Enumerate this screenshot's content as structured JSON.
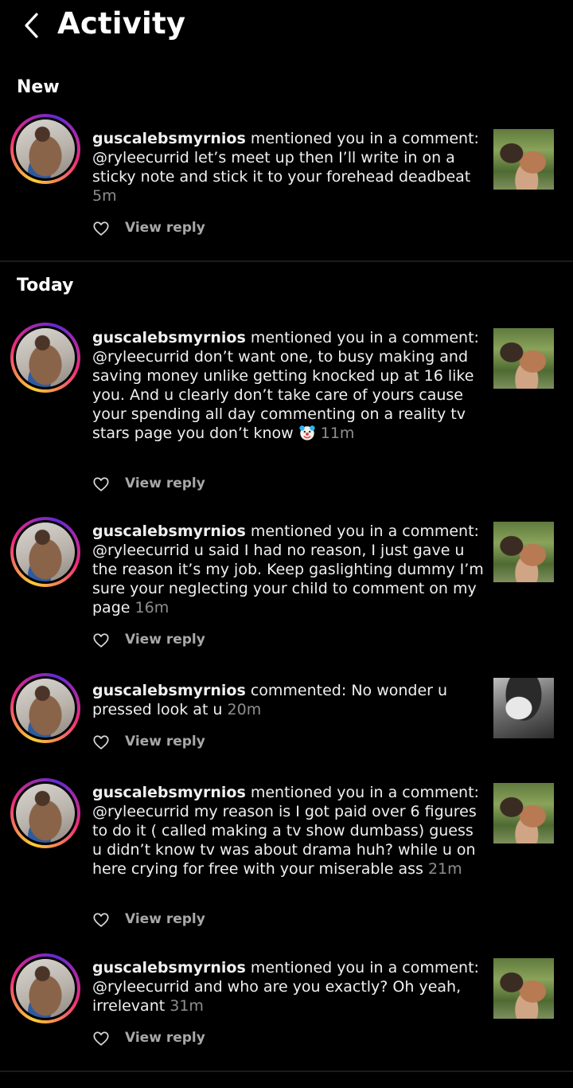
{
  "header": {
    "title": "Activity"
  },
  "sections": {
    "new": "New",
    "today": "Today"
  },
  "reply_label": "View reply",
  "notifications": [
    {
      "username": "guscalebsmyrnios",
      "action": "mentioned you in a comment:",
      "mention": "@ryleecurrid",
      "message": "let’s meet up then I’ll write in on a sticky note and stick it to your forehead deadbeat",
      "time": "5m"
    },
    {
      "username": "guscalebsmyrnios",
      "action": "mentioned you in a comment:",
      "mention": "@ryleecurrid",
      "message": "don’t want one, to busy making and saving money unlike getting knocked up at 16 like you. And u clearly don’t take care of yours cause your spending all day commenting on a reality tv stars page you don’t know",
      "emoji": "clown-face-emoji",
      "time": "11m"
    },
    {
      "username": "guscalebsmyrnios",
      "action": "mentioned you in a comment:",
      "mention": "@ryleecurrid",
      "message": "u said I had no reason, I just gave u the reason it’s my job. Keep gaslighting dummy I’m sure your neglecting your child to comment on my page",
      "time": "16m"
    },
    {
      "username": "guscalebsmyrnios",
      "action": "commented:",
      "mention": "",
      "message": "No wonder u pressed look at u",
      "time": "20m"
    },
    {
      "username": "guscalebsmyrnios",
      "action": "mentioned you in a comment:",
      "mention": "@ryleecurrid",
      "message": "my reason is I got paid over 6 figures to do it ( called making a tv show dumbass) guess u didn’t know tv was about drama huh? while u on here crying for free with your miserable ass",
      "time": "21m"
    },
    {
      "username": "guscalebsmyrnios",
      "action": "mentioned you in a comment:",
      "mention": "@ryleecurrid",
      "message": "and who are you exactly? Oh yeah, irrelevant",
      "time": "31m"
    }
  ],
  "colors": {
    "background": "#000000",
    "timestamp": "#8e8e8e",
    "reply": "#a8a8a8"
  }
}
